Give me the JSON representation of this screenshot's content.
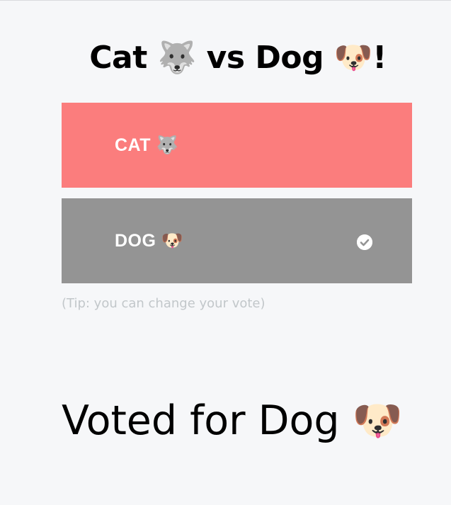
{
  "title": "Cat 🐺 vs Dog 🐶!",
  "options": [
    {
      "label": "CAT 🐺",
      "selected": false,
      "color": "#fb7d7d"
    },
    {
      "label": "DOG 🐶",
      "selected": true,
      "color": "#949494"
    }
  ],
  "selected_icon": "check-circle-icon",
  "tip": "(Tip: you can change your vote)",
  "result": "Voted for Dog 🐶"
}
